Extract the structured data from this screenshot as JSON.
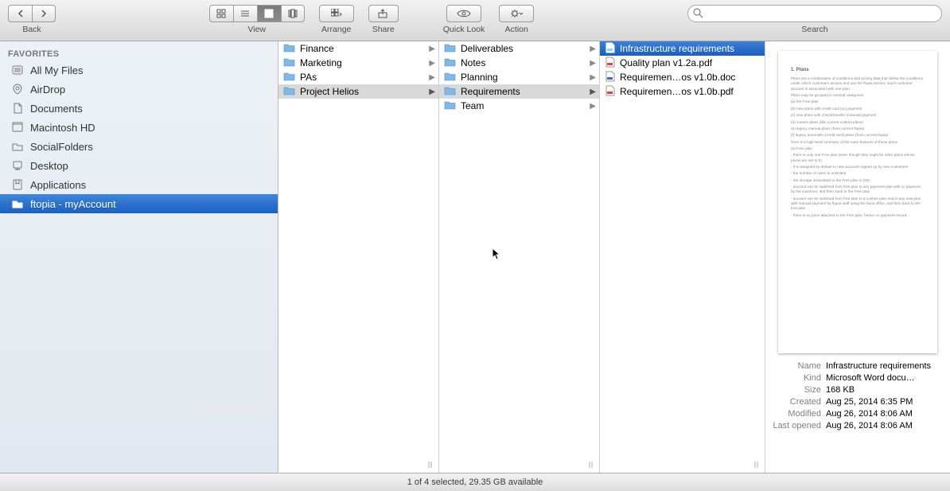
{
  "toolbar": {
    "back": "Back",
    "view": "View",
    "arrange": "Arrange",
    "share": "Share",
    "quicklook": "Quick Look",
    "action": "Action",
    "search": "Search",
    "search_placeholder": ""
  },
  "sidebar": {
    "header": "FAVORITES",
    "items": [
      {
        "label": "All My Files"
      },
      {
        "label": "AirDrop"
      },
      {
        "label": "Documents"
      },
      {
        "label": "Macintosh HD"
      },
      {
        "label": "SocialFolders"
      },
      {
        "label": "Desktop"
      },
      {
        "label": "Applications"
      },
      {
        "label": "ftopia - myAccount"
      }
    ]
  },
  "columns": [
    {
      "rows": [
        {
          "label": "Finance",
          "kind": "folder",
          "hasChildren": true
        },
        {
          "label": "Marketing",
          "kind": "folder",
          "hasChildren": true
        },
        {
          "label": "PAs",
          "kind": "folder",
          "hasChildren": true
        },
        {
          "label": "Project Helios",
          "kind": "folder",
          "hasChildren": true,
          "selected": "grey"
        }
      ]
    },
    {
      "rows": [
        {
          "label": "Deliverables",
          "kind": "folder",
          "hasChildren": true
        },
        {
          "label": "Notes",
          "kind": "folder",
          "hasChildren": true
        },
        {
          "label": "Planning",
          "kind": "folder",
          "hasChildren": true
        },
        {
          "label": "Requirements",
          "kind": "folder",
          "hasChildren": true,
          "selected": "grey"
        },
        {
          "label": "Team",
          "kind": "folder",
          "hasChildren": true
        }
      ]
    },
    {
      "rows": [
        {
          "label": "Infrastructure requirements",
          "kind": "doc",
          "selected": "blue"
        },
        {
          "label": "Quality plan v1.2a.pdf",
          "kind": "pdf"
        },
        {
          "label": "Requiremen…os v1.0b.doc",
          "kind": "doc"
        },
        {
          "label": "Requiremen…os v1.0b.pdf",
          "kind": "pdf"
        }
      ]
    }
  ],
  "preview": {
    "title": "1. Plans",
    "body": "Plans are a combination of conditions and pricing data that define the conditions under which customers access and use the ftopia service. Each customer account is associated with one plan.\nPlans may be grouped in several categories\n(a) the Free plan\n(b) new plans with credit card (cc) payment\n(c) new plans with check/transfer (manual) payment\n(d) custom plans (like current custom plans)\n(e) legacy manual plans (from current ftopia)\n(f) legacy automatic (credit card) plans (from current ftopia)\nHere is a high-level summary of the main features of these plans.\n(a) Free plan\n- there is only one Free plan (even though they might be other plans whose prices are set to 0)\n- it is assigned by default to new accounts signed up by new customers\n- the number of users is unlimited\n- the storage associated to the Free plan is 2Gb\n- account can be switched from free plan to any payment plan with cc payment by the customer, and then back to the Free plan\n- account can be switched from free plan to a custom plan and to any new plan with manual payment by ftopia staff using the back-office, and then back to the free plan\n- there is no price attached to the Free plan, hence no payment record",
    "meta": {
      "Name": "Infrastructure requirements",
      "Kind": "Microsoft Word docu…",
      "Size": "168 KB",
      "Created": "Aug 25, 2014 6:35 PM",
      "Modified": "Aug 26, 2014 8:06 AM",
      "Last opened": "Aug 26, 2014 8:06 AM"
    }
  },
  "status": "1 of 4 selected, 29.35 GB available"
}
